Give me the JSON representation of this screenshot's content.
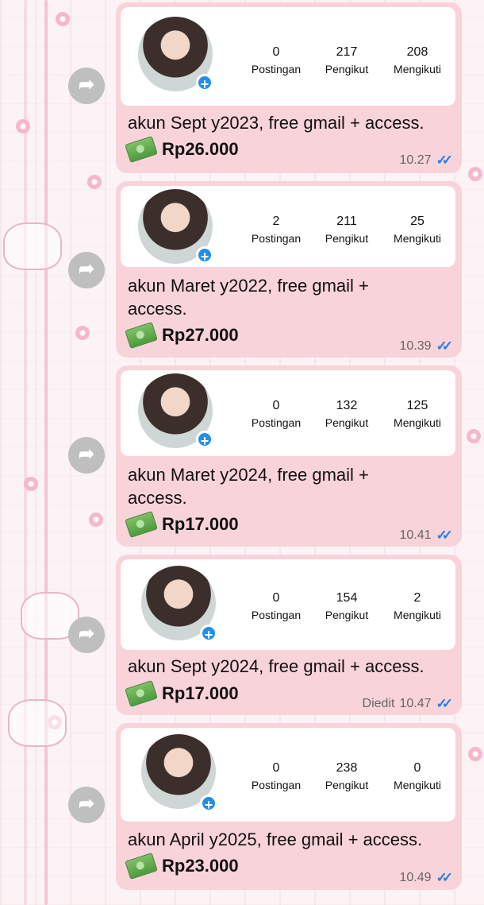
{
  "messages": [
    {
      "posts": "0",
      "followers": "217",
      "following": "208",
      "caption": "akun Sept y2023, free gmail + access.",
      "price": "Rp26.000",
      "edited": "",
      "time": "10.27"
    },
    {
      "posts": "2",
      "followers": "211",
      "following": "25",
      "caption": "akun Maret y2022, free gmail + access.",
      "price": "Rp27.000",
      "edited": "",
      "time": "10.39"
    },
    {
      "posts": "0",
      "followers": "132",
      "following": "125",
      "caption": "akun Maret y2024, free gmail + access.",
      "price": "Rp17.000",
      "edited": "",
      "time": "10.41"
    },
    {
      "posts": "0",
      "followers": "154",
      "following": "2",
      "caption": "akun Sept y2024, free gmail + access.",
      "price": "Rp17.000",
      "edited": "Diedit",
      "time": "10.47"
    },
    {
      "posts": "0",
      "followers": "238",
      "following": "0",
      "caption": "akun April y2025, free gmail + access.",
      "price": "Rp23.000",
      "edited": "",
      "time": "10.49"
    }
  ],
  "labels": {
    "posts": "Postingan",
    "followers": "Pengikut",
    "following": "Mengikuti"
  },
  "icons": {
    "forward": "forward-icon",
    "money": "money-bills-icon",
    "check": "double-check-icon",
    "plus": "plus-icon"
  },
  "colors": {
    "bubble": "#f9d3da",
    "accent_blue": "#1f8fea",
    "checks": "#2b7de0"
  }
}
